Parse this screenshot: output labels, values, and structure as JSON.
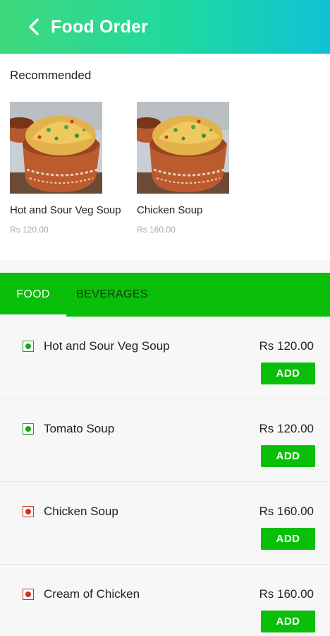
{
  "appbar": {
    "title": "Food Order",
    "back_icon": "chevron-left-icon"
  },
  "recommended": {
    "heading": "Recommended",
    "items": [
      {
        "name": "Hot and Sour Veg Soup",
        "price": "Rs 120.00"
      },
      {
        "name": "Chicken Soup",
        "price": "Rs 160.00"
      }
    ]
  },
  "tabs": [
    {
      "label": "FOOD",
      "active": true
    },
    {
      "label": "BEVERAGES",
      "active": false
    }
  ],
  "menu": {
    "add_label": "ADD",
    "items": [
      {
        "name": "Hot and Sour Veg Soup",
        "price": "Rs 120.00",
        "type": "veg"
      },
      {
        "name": "Tomato Soup",
        "price": "Rs 120.00",
        "type": "veg"
      },
      {
        "name": "Chicken Soup",
        "price": "Rs 160.00",
        "type": "non-veg"
      },
      {
        "name": "Cream of Chicken",
        "price": "Rs 160.00",
        "type": "non-veg"
      }
    ]
  },
  "colors": {
    "accent_green": "#0abf0a",
    "veg_green": "#1aa31a",
    "nonveg_red": "#d0301f",
    "gradient_start": "#3fd87c",
    "gradient_end": "#0fc2d6"
  }
}
